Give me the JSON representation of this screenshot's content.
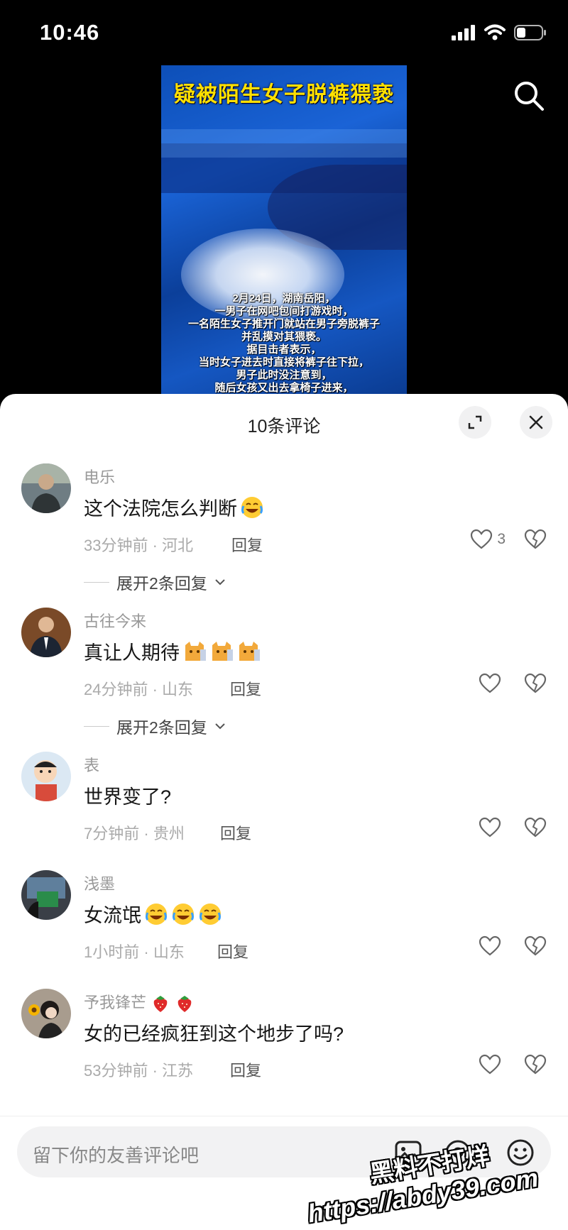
{
  "status_bar": {
    "time": "10:46"
  },
  "video": {
    "title": "疑被陌生女子脱裤猥亵",
    "caption_lines": [
      "2月24日，湖南岳阳，",
      "一男子在网吧包间打游戏时，",
      "一名陌生女子推开门就站在男子旁脱裤子",
      "并乱摸对其猥亵。",
      "据目击者表示，",
      "当时女子进去时直接将裤子往下拉，",
      "男子此时没注意到，",
      "随后女孩又出去拿椅子进来，"
    ]
  },
  "comments_sheet": {
    "title": "10条评论",
    "reply_label": "回复",
    "comments": [
      {
        "user": "电乐",
        "text": "这个法院怎么判断",
        "emojis": [
          "laugh-cry"
        ],
        "time": "33分钟前",
        "location": "河北",
        "likes": "3",
        "expand": "展开2条回复"
      },
      {
        "user": "古往今来",
        "text": "真让人期待",
        "emojis": [
          "cat",
          "cat",
          "cat"
        ],
        "time": "24分钟前",
        "location": "山东",
        "likes": "",
        "expand": "展开2条回复"
      },
      {
        "user": "表",
        "text": "世界变了?",
        "emojis": [],
        "time": "7分钟前",
        "location": "贵州",
        "likes": "",
        "expand": ""
      },
      {
        "user": "浅墨",
        "text": "女流氓",
        "emojis": [
          "laugh-cry",
          "laugh-cry",
          "laugh-cry"
        ],
        "time": "1小时前",
        "location": "山东",
        "likes": "",
        "expand": ""
      },
      {
        "user": "予我锋芒",
        "user_emojis": [
          "strawberry",
          "strawberry"
        ],
        "text": "女的已经疯狂到这个地步了吗?",
        "emojis": [],
        "time": "53分钟前",
        "location": "江苏",
        "likes": "",
        "expand": ""
      }
    ]
  },
  "input": {
    "placeholder": "留下你的友善评论吧"
  },
  "watermark": {
    "line1": "黑料不打烊",
    "line2": "https://abdy39.com"
  },
  "icons": [
    "signal-icon",
    "wifi-icon",
    "battery-icon",
    "search-icon",
    "collapse-icon",
    "close-icon",
    "heart-icon",
    "broken-heart-icon",
    "chevron-down-icon",
    "image-icon",
    "at-icon",
    "smile-icon"
  ],
  "colors": {
    "accent_yellow": "#ffe000",
    "video_blue": "#1a63d6",
    "text_gray": "#999999"
  }
}
